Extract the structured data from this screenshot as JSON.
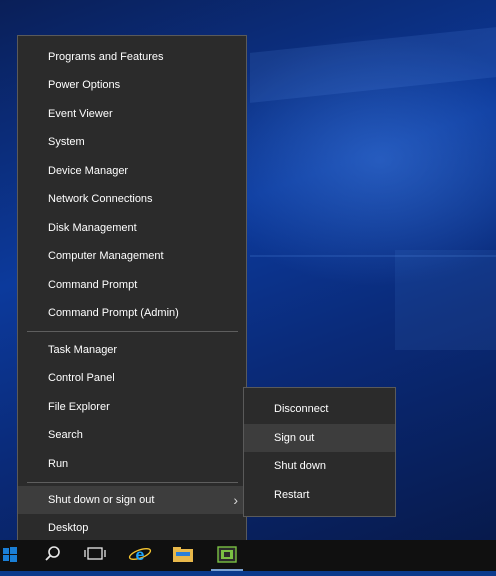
{
  "menu": {
    "items": [
      {
        "label": "Programs and Features"
      },
      {
        "label": "Power Options"
      },
      {
        "label": "Event Viewer"
      },
      {
        "label": "System"
      },
      {
        "label": "Device Manager"
      },
      {
        "label": "Network Connections"
      },
      {
        "label": "Disk Management"
      },
      {
        "label": "Computer Management"
      },
      {
        "label": "Command Prompt"
      },
      {
        "label": "Command Prompt (Admin)"
      },
      {
        "label": "Task Manager"
      },
      {
        "label": "Control Panel"
      },
      {
        "label": "File Explorer"
      },
      {
        "label": "Search"
      },
      {
        "label": "Run"
      },
      {
        "label": "Shut down or sign out"
      },
      {
        "label": "Desktop"
      }
    ],
    "chevron": "›"
  },
  "submenu": {
    "items": [
      {
        "label": "Disconnect"
      },
      {
        "label": "Sign out"
      },
      {
        "label": "Shut down"
      },
      {
        "label": "Restart"
      }
    ]
  },
  "taskbar": {
    "icons": [
      "windows-start-icon",
      "search-icon",
      "task-view-icon",
      "internet-explorer-icon",
      "file-explorer-icon",
      "server-manager-icon"
    ]
  }
}
